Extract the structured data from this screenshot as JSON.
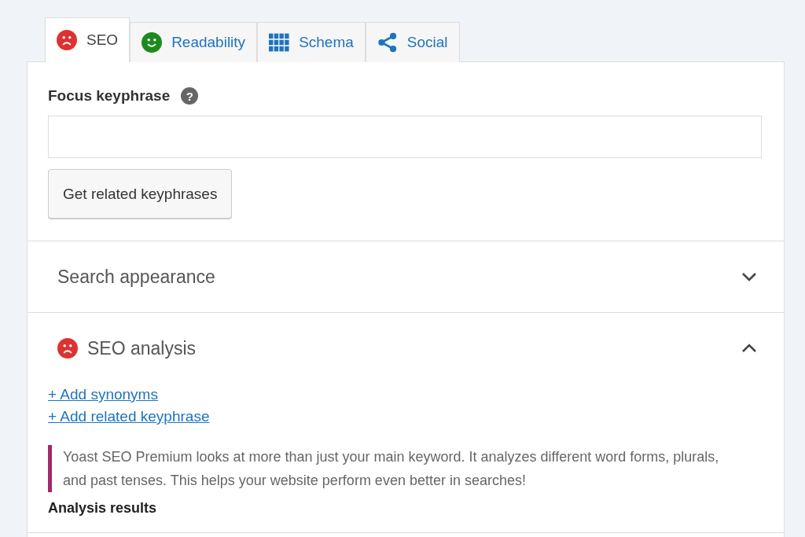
{
  "tabs": [
    {
      "label": "SEO",
      "kind": "sad",
      "selected": true
    },
    {
      "label": "Readability",
      "kind": "smile",
      "selected": false
    },
    {
      "label": "Schema",
      "kind": "grid",
      "selected": false
    },
    {
      "label": "Social",
      "kind": "share",
      "selected": false
    }
  ],
  "focus": {
    "label": "Focus keyphrase",
    "help": "?",
    "button": "Get related keyphrases"
  },
  "sections": [
    {
      "title": "Search appearance",
      "kind": "plain",
      "expanded": false
    },
    {
      "title": "SEO analysis",
      "kind": "sad",
      "expanded": true,
      "links": [
        "+ Add synonyms",
        "+ Add related keyphrase"
      ],
      "notice": "Yoast SEO Premium looks at more than just your main keyword. It analyzes different word forms, plurals, and past tenses. This helps your website perform even better in searches!",
      "subheading": "Analysis results"
    }
  ]
}
